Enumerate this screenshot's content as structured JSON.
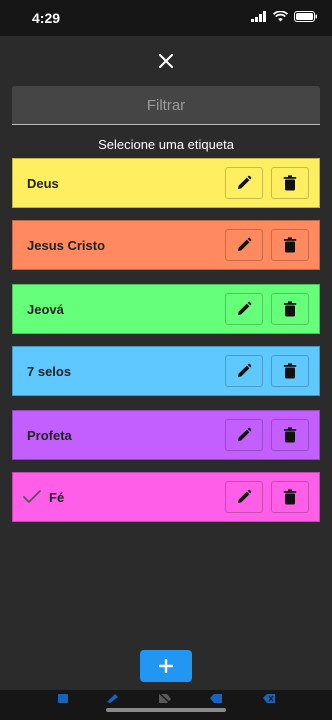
{
  "status": {
    "time": "4:29"
  },
  "filter": {
    "placeholder": "Filtrar"
  },
  "section_title": "Selecione uma etiqueta",
  "tags": [
    {
      "label": "Deus",
      "color": "#ffee5f"
    },
    {
      "label": "Jesus Cristo",
      "color": "#ff8a5f"
    },
    {
      "label": "Jeová",
      "color": "#66ff7a"
    },
    {
      "label": "7 selos",
      "color": "#5fc8ff"
    },
    {
      "label": "Profeta",
      "color": "#c45fff"
    },
    {
      "label": "Fé",
      "color": "#ff5fe8",
      "selected": true
    }
  ],
  "colors": {
    "accent": "#2196f3",
    "background": "#2b2b2b",
    "bar": "#161616"
  },
  "icons": {
    "close": "close-icon",
    "edit": "pencil-icon",
    "delete": "trash-icon",
    "add": "plus-icon",
    "check": "check-icon"
  }
}
